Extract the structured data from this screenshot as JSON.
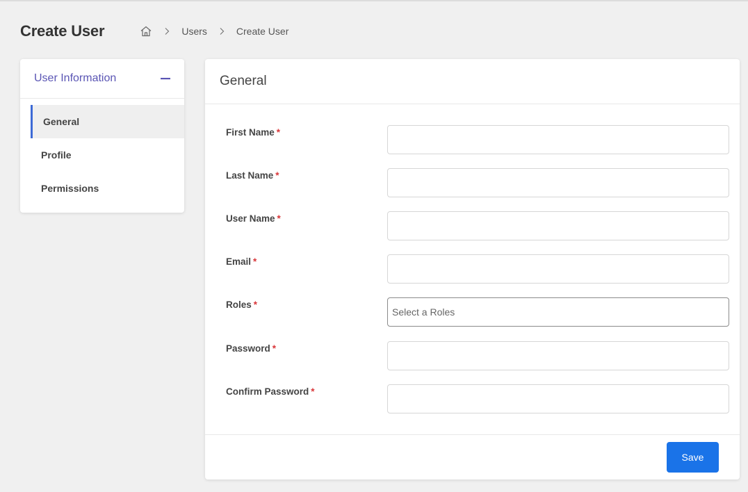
{
  "header": {
    "title": "Create User",
    "breadcrumb": {
      "home_icon": "home-icon",
      "separator_icon": "chevron-right-icon",
      "items": [
        "Users",
        "Create User"
      ]
    }
  },
  "sidebar": {
    "title": "User Information",
    "collapse_icon": "minus-icon",
    "items": [
      {
        "label": "General",
        "active": true
      },
      {
        "label": "Profile",
        "active": false
      },
      {
        "label": "Permissions",
        "active": false
      }
    ]
  },
  "main": {
    "title": "General",
    "required_mark": "*",
    "fields": [
      {
        "label": "First Name",
        "value": "",
        "placeholder": ""
      },
      {
        "label": "Last Name",
        "value": "",
        "placeholder": ""
      },
      {
        "label": "User Name",
        "value": "",
        "placeholder": ""
      },
      {
        "label": "Email",
        "value": "",
        "placeholder": ""
      },
      {
        "label": "Roles",
        "value": "Select a Roles",
        "placeholder": "Select a Roles"
      },
      {
        "label": "Password",
        "value": "",
        "placeholder": ""
      },
      {
        "label": "Confirm Password",
        "value": "",
        "placeholder": ""
      }
    ],
    "save_label": "Save"
  },
  "colors": {
    "accent": "#1a73e8",
    "sidebar_title": "#5a55b4",
    "active_indicator": "#3d6ad6",
    "required": "#d9373a"
  }
}
